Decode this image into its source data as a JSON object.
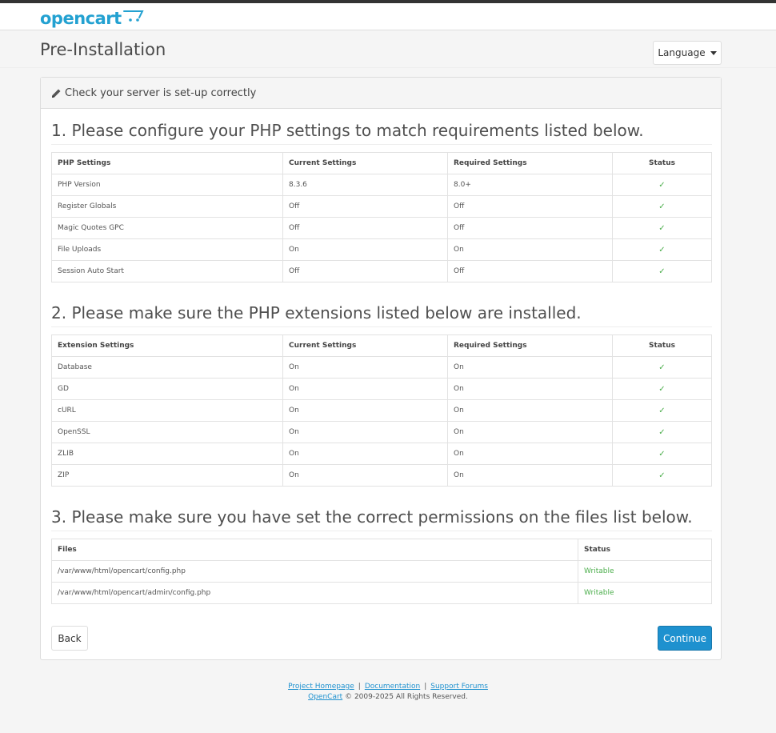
{
  "brand": {
    "logo_text": "opencart",
    "accent": "#23a1d1"
  },
  "page": {
    "title": "Pre-Installation",
    "language_label": "Language"
  },
  "panel": {
    "heading": "Check your server is set-up correctly",
    "icon": "pencil-icon"
  },
  "php_settings": {
    "title": "1. Please configure your PHP settings to match requirements listed below.",
    "headers": [
      "PHP Settings",
      "Current Settings",
      "Required Settings",
      "Status"
    ],
    "rows": [
      [
        "PHP Version",
        "8.3.6",
        "8.0+",
        "✓"
      ],
      [
        "Register Globals",
        "Off",
        "Off",
        "✓"
      ],
      [
        "Magic Quotes GPC",
        "Off",
        "Off",
        "✓"
      ],
      [
        "File Uploads",
        "On",
        "On",
        "✓"
      ],
      [
        "Session Auto Start",
        "Off",
        "Off",
        "✓"
      ]
    ]
  },
  "extensions": {
    "title": "2. Please make sure the PHP extensions listed below are installed.",
    "headers": [
      "Extension Settings",
      "Current Settings",
      "Required Settings",
      "Status"
    ],
    "rows": [
      [
        "Database",
        "On",
        "On",
        "✓"
      ],
      [
        "GD",
        "On",
        "On",
        "✓"
      ],
      [
        "cURL",
        "On",
        "On",
        "✓"
      ],
      [
        "OpenSSL",
        "On",
        "On",
        "✓"
      ],
      [
        "ZLIB",
        "On",
        "On",
        "✓"
      ],
      [
        "ZIP",
        "On",
        "On",
        "✓"
      ]
    ]
  },
  "permissions": {
    "title": "3. Please make sure you have set the correct permissions on the files list below.",
    "headers": [
      "Files",
      "Status"
    ],
    "rows": [
      [
        "/var/www/html/opencart/config.php",
        "Writable"
      ],
      [
        "/var/www/html/opencart/admin/config.php",
        "Writable"
      ]
    ]
  },
  "actions": {
    "back_label": "Back",
    "continue_label": "Continue"
  },
  "footer": {
    "link_homepage": "Project Homepage",
    "link_docs": "Documentation",
    "link_forums": "Support Forums",
    "separator": "|",
    "brand_link": "OpenCart",
    "copyright": "© 2009-2025 All Rights Reserved."
  },
  "colors": {
    "ok": "#4cae4c",
    "primary": "#1e91cf"
  }
}
